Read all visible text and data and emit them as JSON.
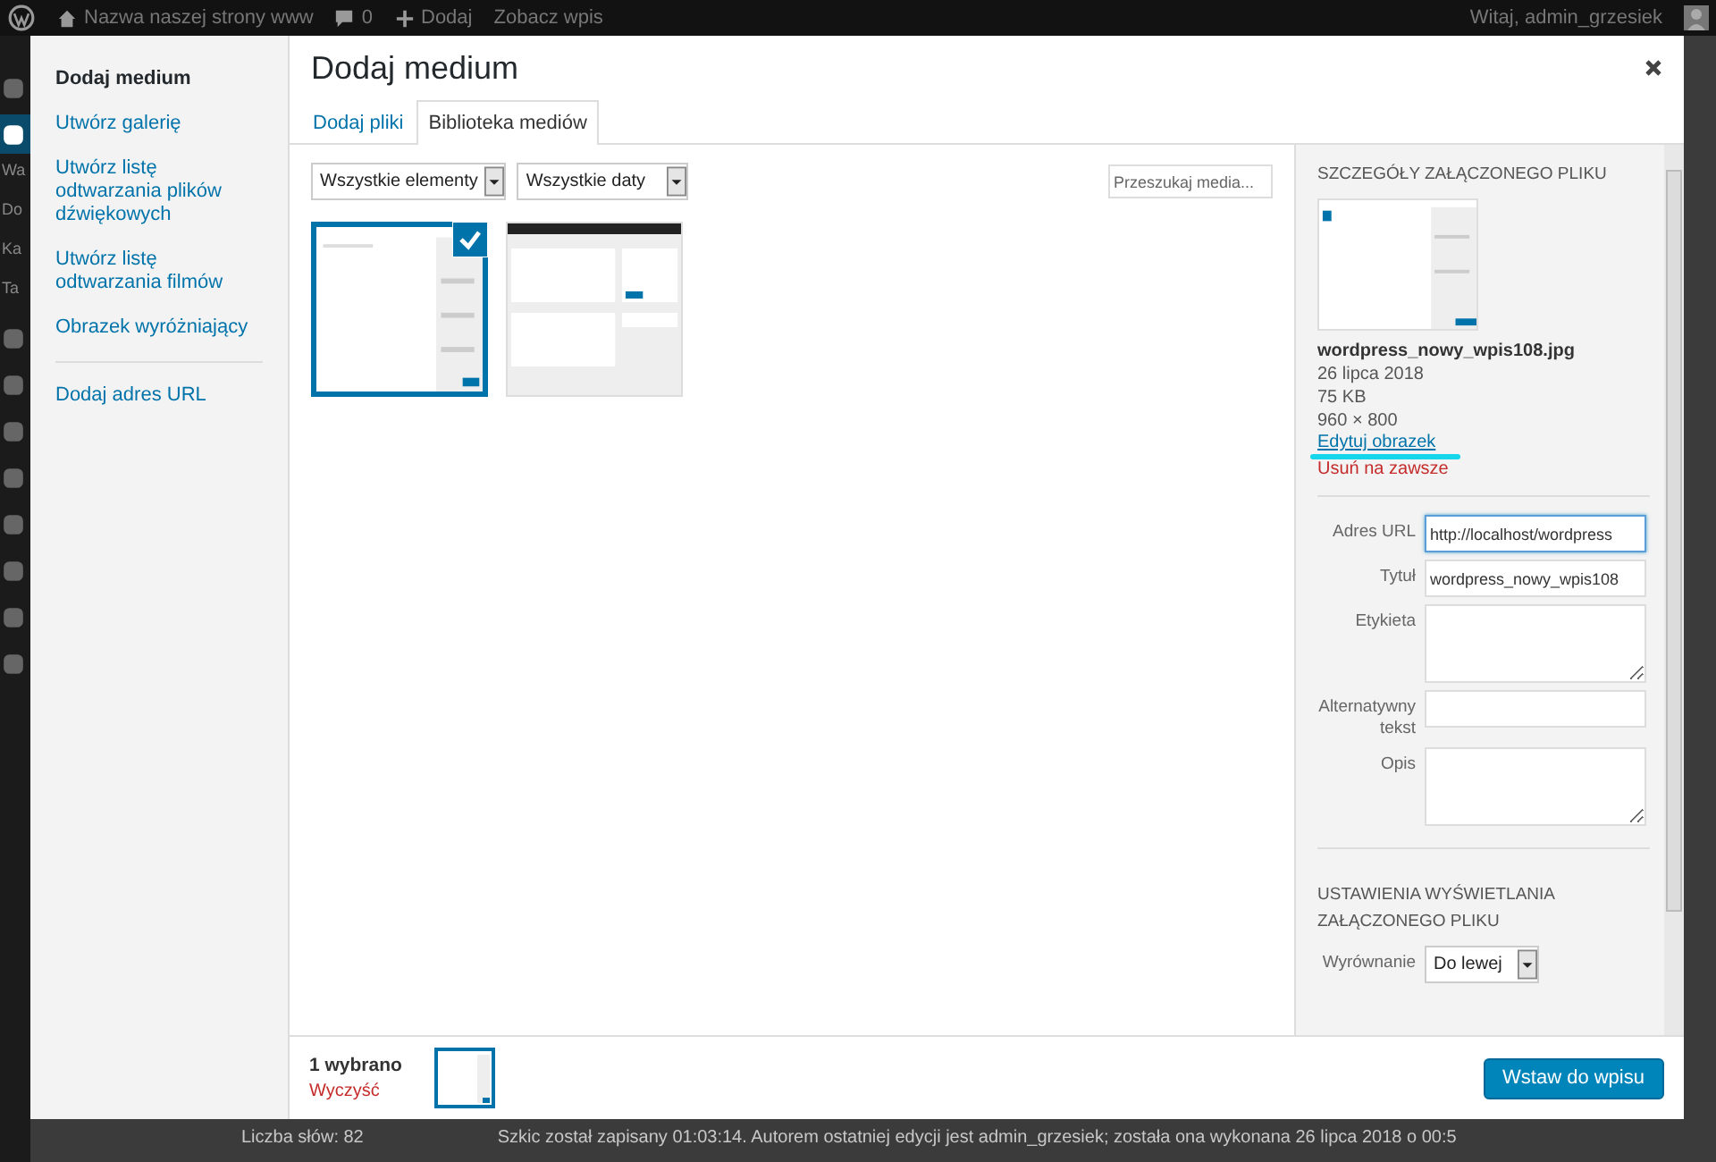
{
  "admin_bar": {
    "site": "Nazwa naszej strony www",
    "comments": "0",
    "new": "Dodaj",
    "view": "Zobacz wpis",
    "greeting": "Witaj, admin_grzesiek"
  },
  "admin_menu": [
    {
      "kind": "icon",
      "selected": false
    },
    {
      "kind": "icon",
      "selected": true
    },
    {
      "kind": "text",
      "text": "Wa",
      "selected": false
    },
    {
      "kind": "text",
      "text": "Do",
      "selected": false
    },
    {
      "kind": "text",
      "text": "Ka",
      "selected": false
    },
    {
      "kind": "text",
      "text": "Ta",
      "selected": false
    },
    {
      "kind": "icon",
      "selected": false
    },
    {
      "kind": "icon",
      "selected": false
    },
    {
      "kind": "icon",
      "selected": false
    },
    {
      "kind": "icon",
      "selected": false
    },
    {
      "kind": "icon",
      "selected": false
    },
    {
      "kind": "icon",
      "selected": false
    },
    {
      "kind": "icon",
      "selected": false
    },
    {
      "kind": "icon",
      "selected": false
    }
  ],
  "editor_status": {
    "word_count": "Liczba słów: 82",
    "draft_note": "Szkic został zapisany 01:03:14. Autorem ostatniej edycji jest admin_grzesiek; została ona wykonana 26 lipca 2018 o 00:5"
  },
  "modal": {
    "title": "Dodaj medium",
    "menu": [
      [
        {
          "label": "Dodaj medium",
          "selected": true
        },
        {
          "label": "Utwórz galerię",
          "selected": false
        },
        {
          "label": "Utwórz listę odtwarzania plików dźwiękowych",
          "selected": false
        },
        {
          "label": "Utwórz listę odtwarzania filmów",
          "selected": false
        },
        {
          "label": "Obrazek wyróżniający",
          "selected": false
        }
      ],
      [
        {
          "label": "Dodaj adres URL",
          "selected": false
        }
      ]
    ],
    "tabs": [
      {
        "label": "Dodaj pliki",
        "selected": false
      },
      {
        "label": "Biblioteka mediów",
        "selected": true
      }
    ],
    "filters": [
      {
        "value": "Wszystkie elementy"
      },
      {
        "value": "Wszystkie daty"
      }
    ],
    "search": {
      "placeholder": "Przeszukaj media..."
    },
    "attachments": [
      {
        "kind": "picture",
        "selected": true
      },
      {
        "kind": "picture",
        "selected": false
      }
    ],
    "details": {
      "heading": "SZCZEGÓŁY ZAŁĄCZONEGO PLIKU",
      "filename": "wordpress_nowy_wpis108.jpg",
      "date": "26 lipca 2018",
      "size": "75 KB",
      "dimensions": "960 × 800",
      "edit_link": "Edytuj obrazek",
      "delete_link": "Usuń na zawsze",
      "fields": [
        {
          "label": "Adres URL",
          "kind": "input",
          "value": "http://localhost/wordpress",
          "focused": true
        },
        {
          "label": "Tytuł",
          "kind": "input",
          "value": "wordpress_nowy_wpis108",
          "focused": false
        },
        {
          "label": "Etykieta",
          "kind": "textarea",
          "focused": false
        },
        {
          "label": "Alternatywny tekst",
          "kind": "input",
          "focused": false
        },
        {
          "label": "Opis",
          "kind": "textarea",
          "focused": false
        }
      ],
      "display_heading": "USTAWIENIA WYŚWIETLANIA ZAŁĄCZONEGO PLIKU",
      "alignment": {
        "label": "Wyrównanie",
        "value": "Do lewej"
      }
    },
    "footer": {
      "count": "1 wybrano",
      "clear": "Wyczyść",
      "insert_button": "Wstaw do wpisu"
    }
  }
}
